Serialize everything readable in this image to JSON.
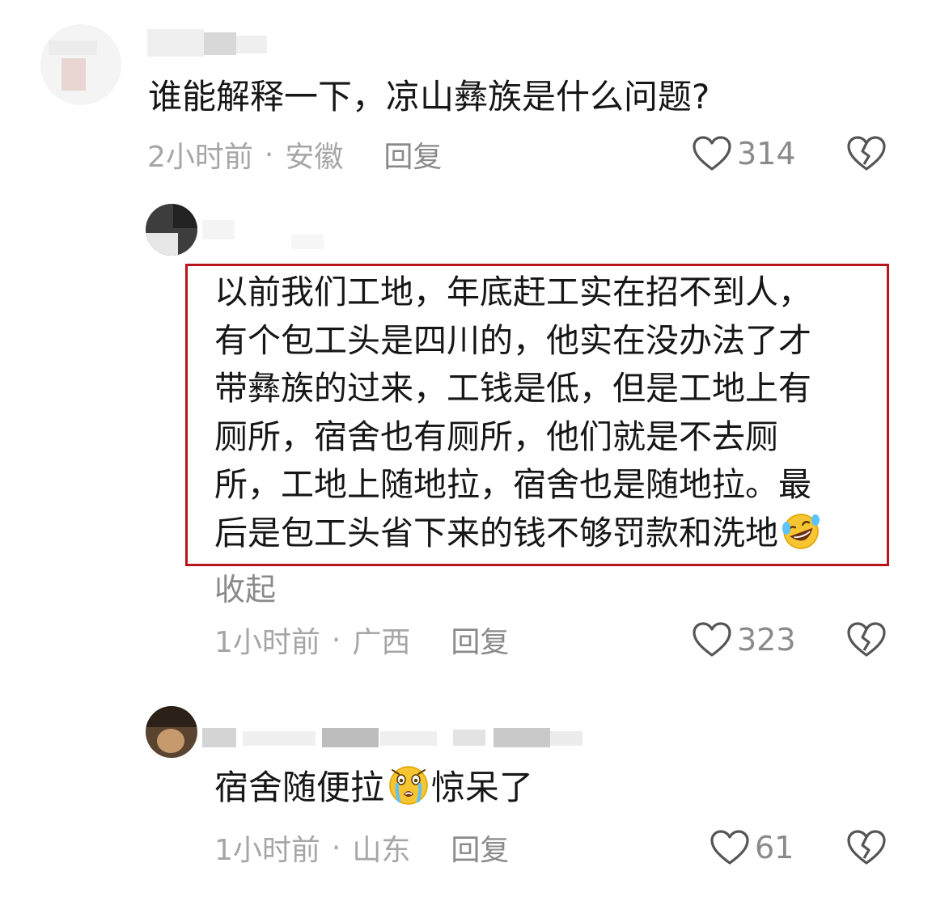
{
  "comments": [
    {
      "text": "谁能解释一下，凉山彝族是什么问题?",
      "time": "2小时前",
      "separator": "·",
      "location": "安徽",
      "reply_label": "回复",
      "likes": "314"
    },
    {
      "lines": [
        "以前我们工地，年底赶工实在招不到人，",
        "有个包工头是四川的，他实在没办法了才",
        "带彝族的过来，工钱是低，但是工地上有",
        "厕所，宿舍也有厕所，他们就是不去厕",
        "所，工地上随地拉，宿舍也是随地拉。最",
        "后是包工头省下来的钱不够罚款和洗地"
      ],
      "collapse_label": "收起",
      "time": "1小时前",
      "separator": "·",
      "location": "广西",
      "reply_label": "回复",
      "likes": "323"
    },
    {
      "text_before": "宿舍随便拉",
      "text_after": "惊呆了",
      "time": "1小时前",
      "separator": "·",
      "location": "山东",
      "reply_label": "回复",
      "likes": "61"
    }
  ],
  "icons": {
    "like": "heart-outline-icon",
    "dislike": "broken-heart-icon",
    "emoji_laugh": "rolling-laughing-emoji",
    "emoji_shock": "shocked-crying-emoji"
  },
  "colors": {
    "text": "#161616",
    "meta": "#a6a6a6",
    "highlight_border": "#b8141b",
    "emoji_yellow": "#f7c531"
  }
}
